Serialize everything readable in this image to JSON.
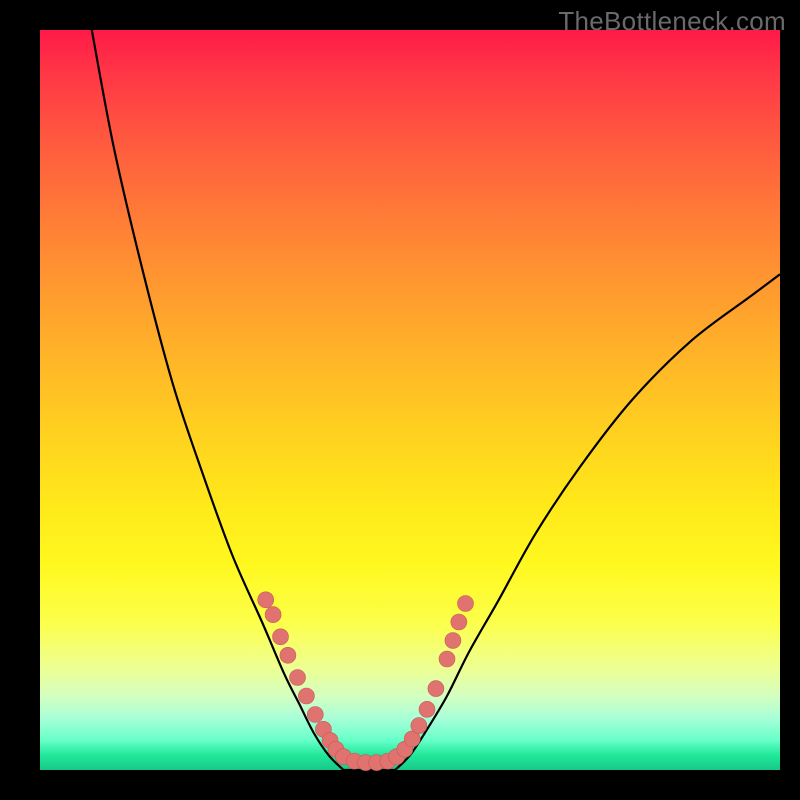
{
  "watermark": "TheBottleneck.com",
  "chart_data": {
    "type": "line",
    "title": "",
    "xlabel": "",
    "ylabel": "",
    "xlim": [
      0,
      100
    ],
    "ylim": [
      0,
      100
    ],
    "grid": false,
    "legend": false,
    "series": [
      {
        "name": "left-curve",
        "x": [
          7,
          10,
          14,
          18,
          22,
          26,
          30,
          33,
          35,
          37,
          39,
          41
        ],
        "values": [
          100,
          84,
          67,
          52,
          40,
          29,
          20,
          13,
          9,
          5,
          2,
          0
        ]
      },
      {
        "name": "right-curve",
        "x": [
          48,
          50,
          52,
          55,
          58,
          62,
          67,
          73,
          80,
          88,
          96,
          100
        ],
        "values": [
          0,
          2,
          5,
          10,
          16,
          23,
          32,
          41,
          50,
          58,
          64,
          67
        ]
      },
      {
        "name": "valley-floor",
        "x": [
          41,
          43,
          45,
          47,
          48
        ],
        "values": [
          0,
          0,
          0,
          0,
          0
        ]
      }
    ],
    "points": {
      "name": "highlighted-dots",
      "color": "#e0736f",
      "x": [
        30.5,
        31.5,
        32.5,
        33.5,
        34.8,
        36.0,
        37.2,
        38.3,
        39.2,
        40.0,
        41.0,
        42.5,
        44.0,
        45.5,
        47.0,
        48.2,
        49.3,
        50.3,
        51.2,
        52.3,
        53.5,
        55.0,
        55.8,
        56.6,
        57.5
      ],
      "values": [
        23.0,
        21.0,
        18.0,
        15.5,
        12.5,
        10.0,
        7.5,
        5.5,
        4.0,
        2.8,
        1.8,
        1.2,
        1.0,
        1.0,
        1.2,
        1.8,
        2.8,
        4.2,
        6.0,
        8.2,
        11.0,
        15.0,
        17.5,
        20.0,
        22.5
      ]
    }
  }
}
